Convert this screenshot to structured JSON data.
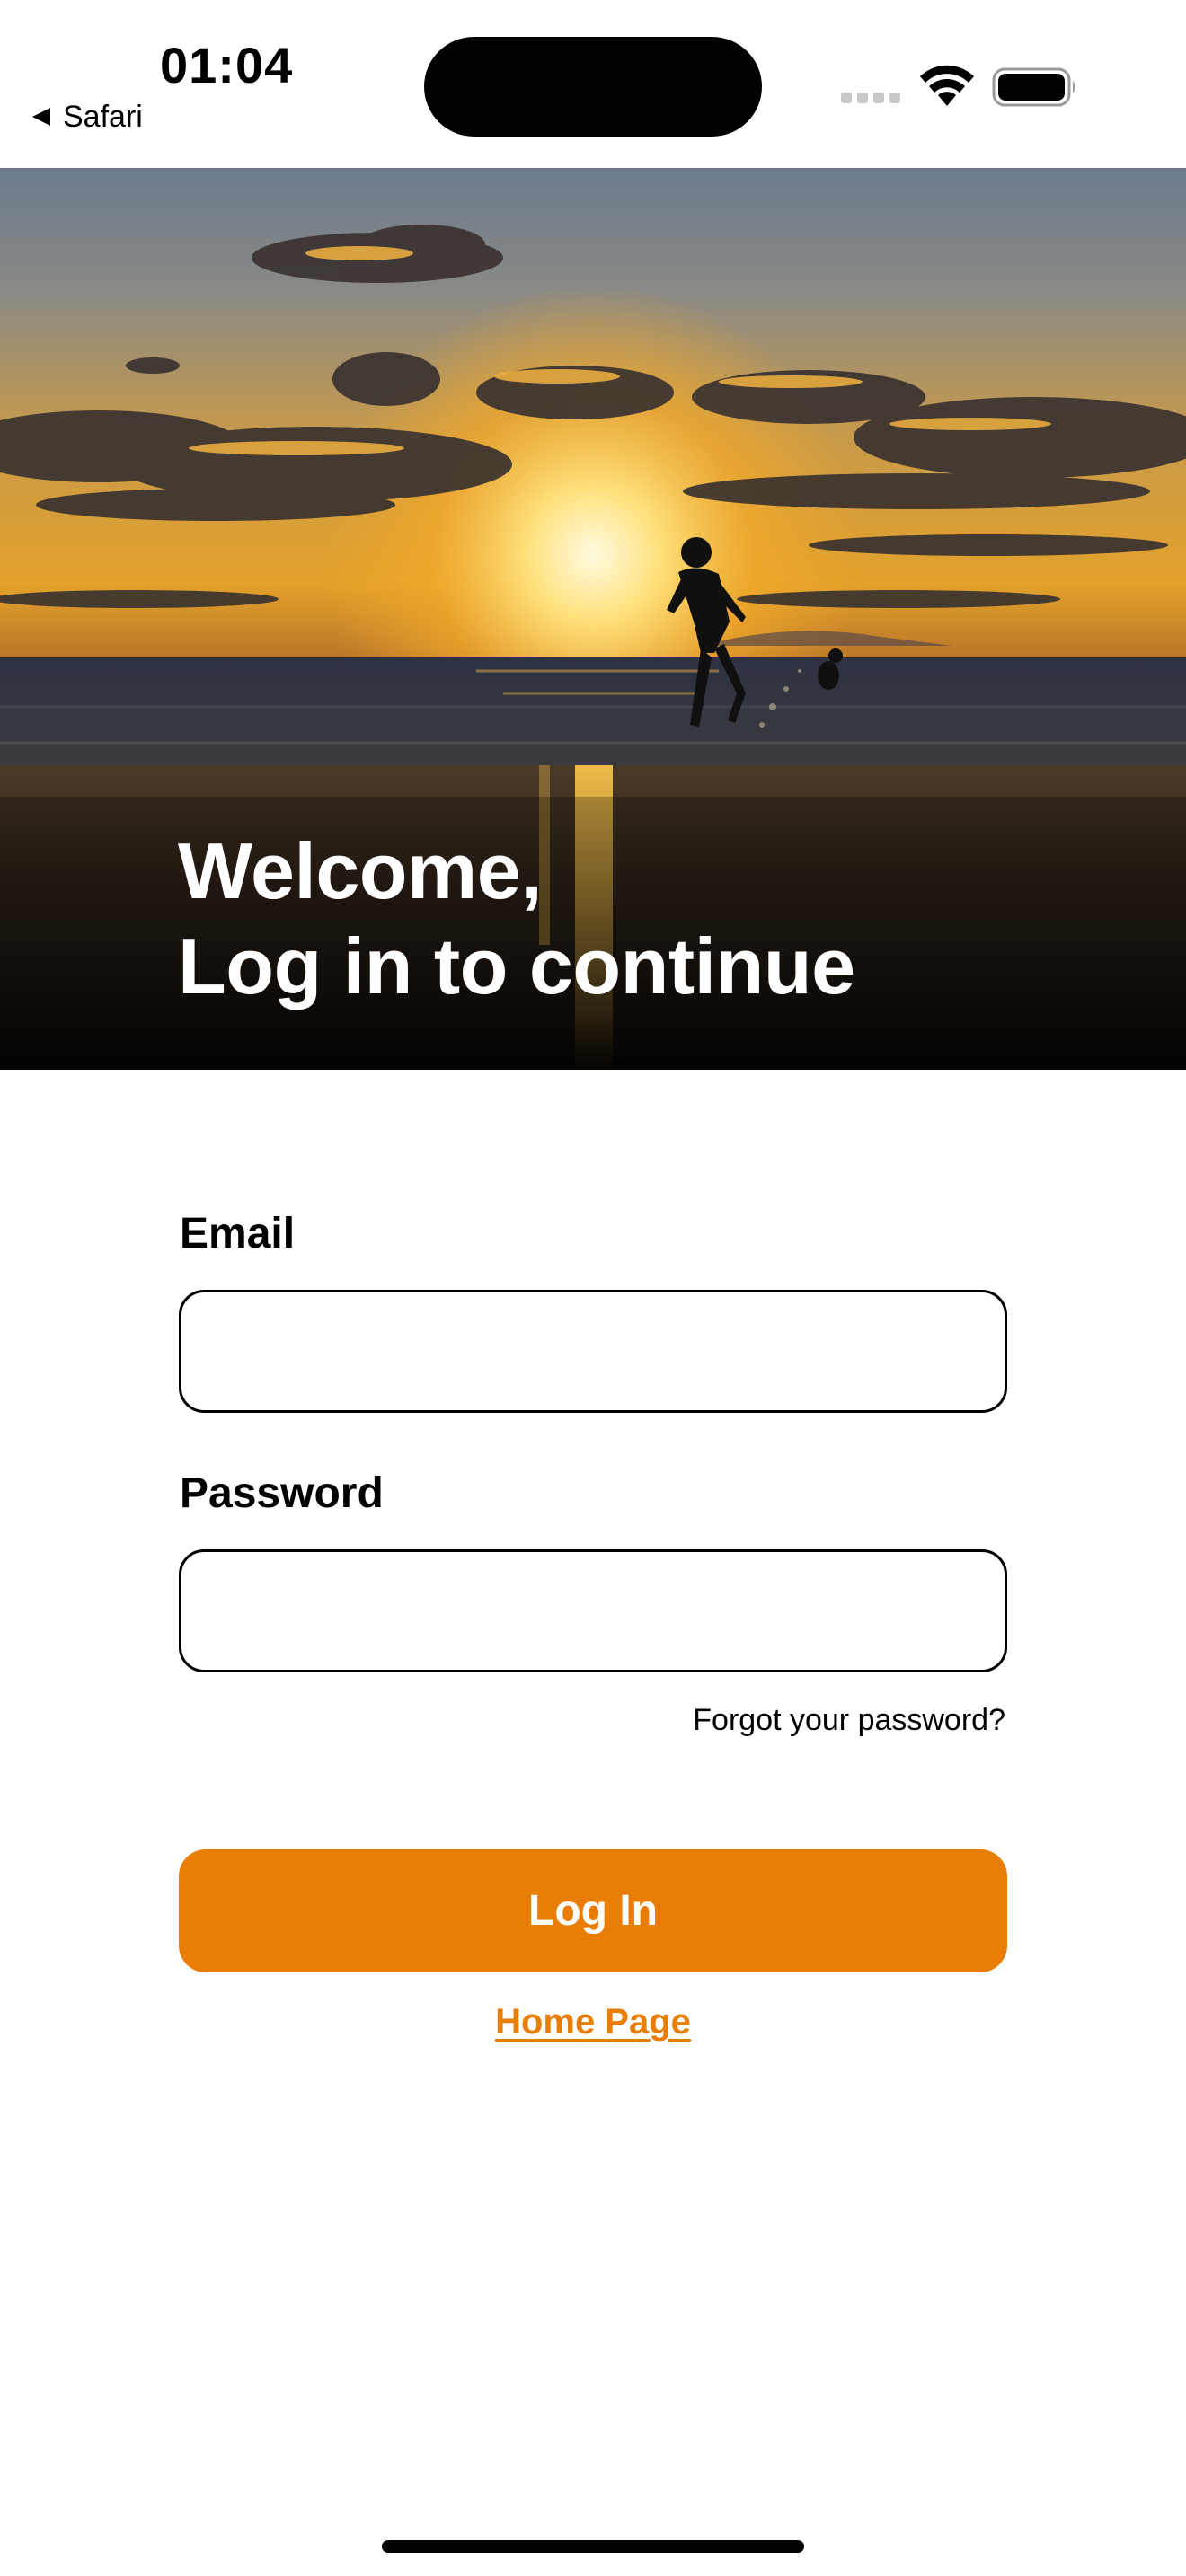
{
  "status_bar": {
    "time": "01:04",
    "back_label": "Safari",
    "icons": [
      "signal-icon",
      "wifi-icon",
      "battery-icon"
    ]
  },
  "hero": {
    "title_line1": "Welcome,",
    "title_line2": "Log in to continue"
  },
  "form": {
    "email_label": "Email",
    "email_value": "",
    "email_placeholder": "",
    "password_label": "Password",
    "password_value": "",
    "password_placeholder": "",
    "forgot_label": "Forgot your password?",
    "login_label": "Log In",
    "home_link_label": "Home Page"
  },
  "colors": {
    "accent": "#e87e06",
    "text": "#000000",
    "background": "#ffffff"
  }
}
